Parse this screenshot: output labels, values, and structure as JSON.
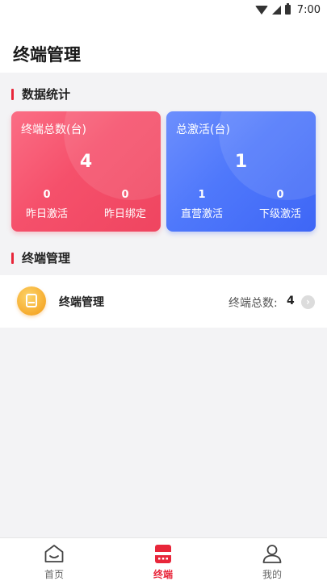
{
  "status_bar": {
    "time": "7:00"
  },
  "header": {
    "title": "终端管理"
  },
  "sections": {
    "stats_title": "数据统计",
    "terminal_title": "终端管理"
  },
  "cards": {
    "total": {
      "title": "终端总数(台)",
      "value": "4",
      "left_num": "0",
      "left_label": "昨日激活",
      "right_num": "0",
      "right_label": "昨日绑定",
      "color": "#f5506b"
    },
    "activation": {
      "title": "总激活(台)",
      "value": "1",
      "left_num": "1",
      "left_label": "直营激活",
      "right_num": "0",
      "right_label": "下级激活",
      "color": "#4f78fb"
    }
  },
  "terminal_row": {
    "name": "终端管理",
    "count_label": "终端总数:",
    "count": "4",
    "icon": "terminal-device-icon"
  },
  "bottom_nav": {
    "items": [
      {
        "label": "首页",
        "icon": "home-icon",
        "active": false
      },
      {
        "label": "终端",
        "icon": "terminal-icon",
        "active": true
      },
      {
        "label": "我的",
        "icon": "user-icon",
        "active": false
      }
    ],
    "active_color": "#e8263a"
  }
}
